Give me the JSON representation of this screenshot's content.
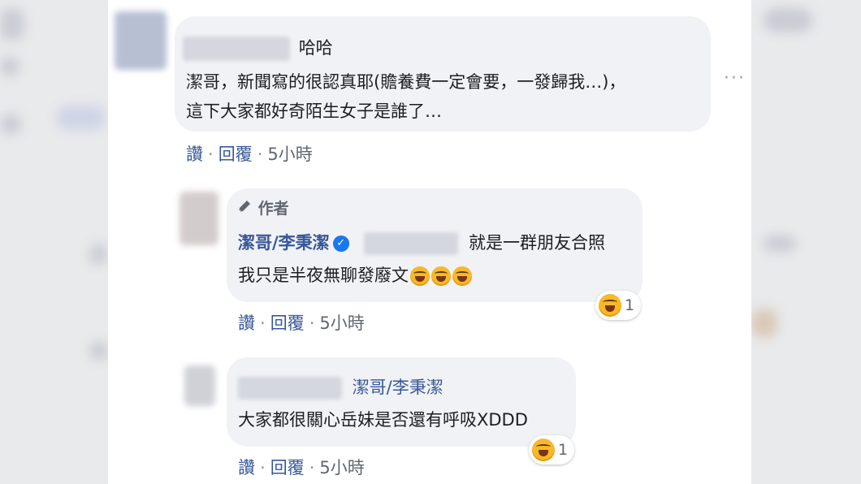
{
  "comments": [
    {
      "first_line_suffix": "哈哈",
      "text_lines": [
        "潔哥，新聞寫的很認真耶(贍養費一定會要，一發歸我…)，",
        "這下大家都好奇陌生女子是誰了…"
      ],
      "actions": {
        "like": "讚",
        "reply": "回覆",
        "time": "5小時"
      },
      "more": "···"
    },
    {
      "badge": "作者",
      "author": "潔哥/李秉潔",
      "verified_mark": "✓",
      "line1_text": "就是一群朋友合照",
      "line2_text": "我只是半夜無聊發廢文",
      "reaction_count": "1",
      "actions": {
        "like": "讚",
        "reply": "回覆",
        "time": "5小時"
      }
    },
    {
      "mention": "潔哥/李秉潔",
      "text": "大家都很關心岳妹是否還有呼吸XDDD",
      "reaction_count": "1",
      "actions": {
        "like": "讚",
        "reply": "回覆",
        "time": "5小時"
      }
    }
  ],
  "icons": {
    "badge_icon": "pencil-icon",
    "reaction_icon": "laughing-face-icon",
    "verified_icon": "verified-check-icon"
  }
}
